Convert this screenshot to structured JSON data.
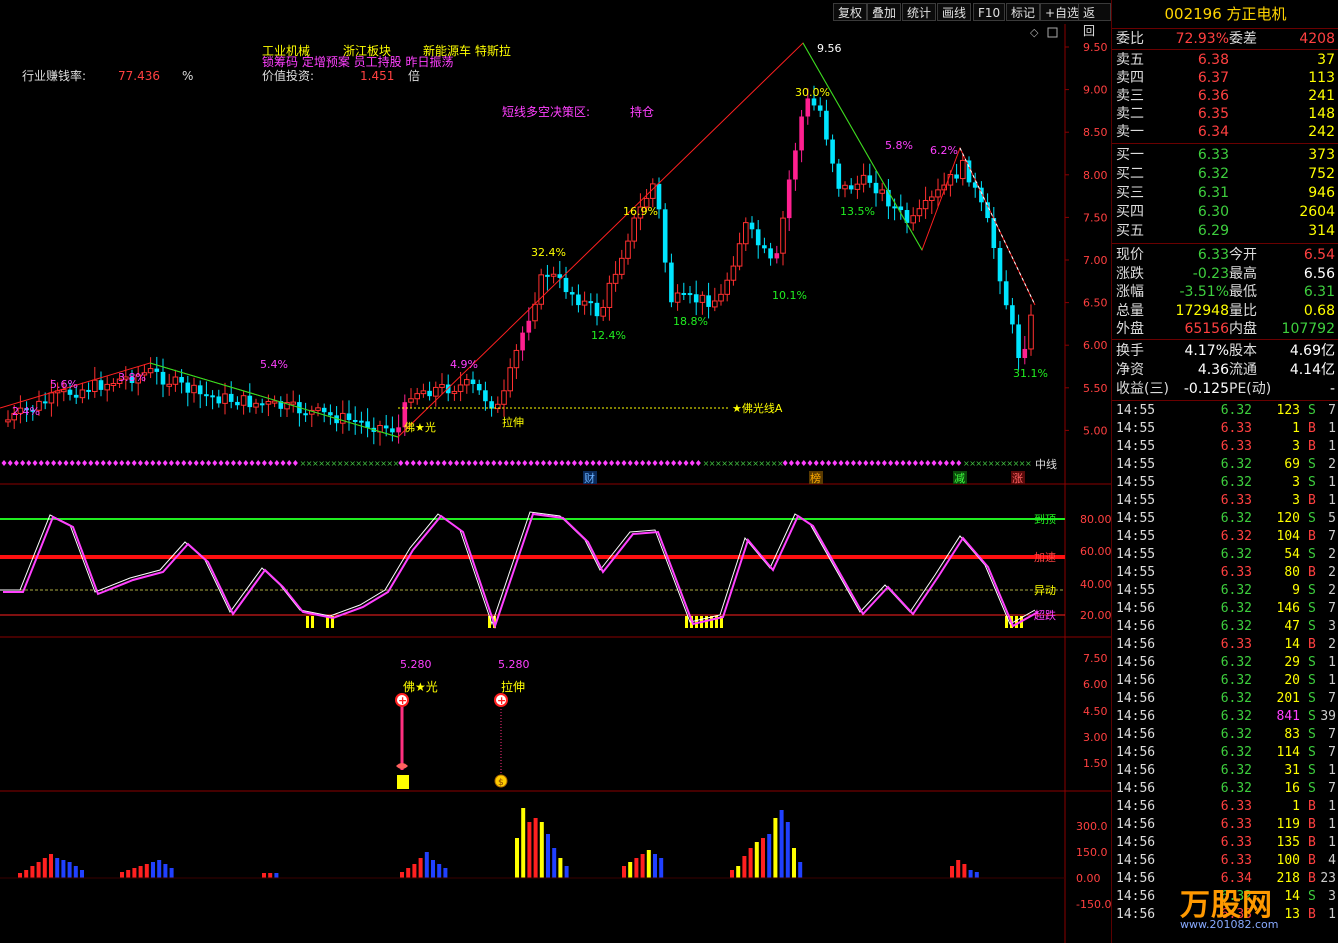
{
  "toolbar": {
    "buttons": [
      "复权",
      "叠加",
      "统计",
      "画线",
      "F10",
      "标记",
      "+自选",
      "返回"
    ]
  },
  "stock": {
    "code_name": "002196 方正电机"
  },
  "order_book": {
    "webi_label": "委比",
    "webi_value": "72.93%",
    "weicha_label": "委差",
    "weicha_value": "4208",
    "asks": [
      {
        "label": "卖五",
        "price": "6.38",
        "vol": "37"
      },
      {
        "label": "卖四",
        "price": "6.37",
        "vol": "113"
      },
      {
        "label": "卖三",
        "price": "6.36",
        "vol": "241"
      },
      {
        "label": "卖二",
        "price": "6.35",
        "vol": "148"
      },
      {
        "label": "卖一",
        "price": "6.34",
        "vol": "242"
      }
    ],
    "bids": [
      {
        "label": "买一",
        "price": "6.33",
        "vol": "373"
      },
      {
        "label": "买二",
        "price": "6.32",
        "vol": "752"
      },
      {
        "label": "买三",
        "price": "6.31",
        "vol": "946"
      },
      {
        "label": "买四",
        "price": "6.30",
        "vol": "2604"
      },
      {
        "label": "买五",
        "price": "6.29",
        "vol": "314"
      }
    ]
  },
  "quote": [
    {
      "l1": "现价",
      "v1": "6.33",
      "c1": "green",
      "l2": "今开",
      "v2": "6.54",
      "c2": "red"
    },
    {
      "l1": "涨跌",
      "v1": "-0.23",
      "c1": "green",
      "l2": "最高",
      "v2": "6.56",
      "c2": "white"
    },
    {
      "l1": "涨幅",
      "v1": "-3.51%",
      "c1": "green",
      "l2": "最低",
      "v2": "6.31",
      "c2": "green"
    },
    {
      "l1": "总量",
      "v1": "172948",
      "c1": "yellow",
      "l2": "量比",
      "v2": "0.68",
      "c2": "yellow"
    },
    {
      "l1": "外盘",
      "v1": "65156",
      "c1": "red",
      "l2": "内盘",
      "v2": "107792",
      "c2": "green"
    }
  ],
  "fundamentals": [
    {
      "l1": "换手",
      "v1": "4.17%",
      "l2": "股本",
      "v2": "4.69亿"
    },
    {
      "l1": "净资",
      "v1": "4.36",
      "l2": "流通",
      "v2": "4.14亿"
    },
    {
      "l1": "收益(三)",
      "v1": "-0.125",
      "l2": "PE(动)",
      "v2": "-"
    }
  ],
  "ticks": [
    [
      "14:55",
      "6.32",
      "123",
      "S",
      "7"
    ],
    [
      "14:55",
      "6.33",
      "1",
      "B",
      "1"
    ],
    [
      "14:55",
      "6.33",
      "3",
      "B",
      "1"
    ],
    [
      "14:55",
      "6.32",
      "69",
      "S",
      "2"
    ],
    [
      "14:55",
      "6.32",
      "3",
      "S",
      "1"
    ],
    [
      "14:55",
      "6.33",
      "3",
      "B",
      "1"
    ],
    [
      "14:55",
      "6.32",
      "120",
      "S",
      "5"
    ],
    [
      "14:55",
      "6.32",
      "104",
      "B",
      "7"
    ],
    [
      "14:55",
      "6.32",
      "54",
      "S",
      "2"
    ],
    [
      "14:55",
      "6.33",
      "80",
      "B",
      "2"
    ],
    [
      "14:55",
      "6.32",
      "9",
      "S",
      "2"
    ],
    [
      "14:56",
      "6.32",
      "146",
      "S",
      "7"
    ],
    [
      "14:56",
      "6.32",
      "47",
      "S",
      "3"
    ],
    [
      "14:56",
      "6.33",
      "14",
      "B",
      "2"
    ],
    [
      "14:56",
      "6.32",
      "29",
      "S",
      "1"
    ],
    [
      "14:56",
      "6.32",
      "20",
      "S",
      "1"
    ],
    [
      "14:56",
      "6.32",
      "201",
      "S",
      "7"
    ],
    [
      "14:56",
      "6.32",
      "841",
      "S",
      "39"
    ],
    [
      "14:56",
      "6.32",
      "83",
      "S",
      "7"
    ],
    [
      "14:56",
      "6.32",
      "114",
      "S",
      "7"
    ],
    [
      "14:56",
      "6.32",
      "31",
      "S",
      "1"
    ],
    [
      "14:56",
      "6.32",
      "16",
      "S",
      "7"
    ],
    [
      "14:56",
      "6.33",
      "1",
      "B",
      "1"
    ],
    [
      "14:56",
      "6.33",
      "119",
      "B",
      "1"
    ],
    [
      "14:56",
      "6.33",
      "135",
      "B",
      "1"
    ],
    [
      "14:56",
      "6.33",
      "100",
      "B",
      "4"
    ],
    [
      "14:56",
      "6.34",
      "218",
      "B",
      "23"
    ],
    [
      "14:56",
      "6.32",
      "14",
      "S",
      "3"
    ],
    [
      "14:56",
      "6.33",
      "13",
      "B",
      "1"
    ]
  ],
  "main_chart": {
    "info": {
      "label1": "行业赚钱率:",
      "value1": "77.436",
      "unit1": "%",
      "label2": "价值投资:",
      "value2": "1.451",
      "unit2": "倍",
      "sector1": "工业机械",
      "sector2": "浙江板块",
      "sector3": "新能源车 特斯拉",
      "tags": "锁筹码 定增预案 员工持股 昨日振荡",
      "decision_label": "短线多空决策区:",
      "decision_value": "持仓"
    },
    "y_ticks": [
      "9.50",
      "9.00",
      "8.50",
      "8.00",
      "7.50",
      "7.00",
      "6.50",
      "6.00",
      "5.50",
      "5.00"
    ],
    "pct_labels": [
      "2.4%",
      "5.6%",
      "3.8%",
      "5.4%",
      "4.9%",
      "32.4%",
      "12.4%",
      "16.9%",
      "18.8%",
      "10.1%",
      "30.0%",
      "13.5%",
      "5.8%",
      "6.2%",
      "31.1%"
    ],
    "high_label": "9.56",
    "signal1": "佛★光",
    "signal2": "拉伸",
    "line_label": "★佛光线A",
    "mid_label": "中线",
    "event_markers": [
      "财",
      "榜",
      "减",
      "涨"
    ]
  },
  "osc_chart": {
    "y_ticks": [
      "80.00",
      "60.00",
      "40.00",
      "20.00"
    ],
    "labels": [
      "到顶",
      "加速",
      "异动",
      "超跌"
    ]
  },
  "signal_chart": {
    "y_ticks": [
      "7.50",
      "6.00",
      "4.50",
      "3.00",
      "1.50"
    ],
    "sig1_value": "5.280",
    "sig1_label": "佛★光",
    "sig2_value": "5.280",
    "sig2_label": "拉伸"
  },
  "vol_chart": {
    "y_ticks": [
      "300.0",
      "150.0",
      "0.00",
      "-150.0"
    ]
  },
  "watermark": {
    "text": "万股网",
    "url": "www.201082.com"
  }
}
